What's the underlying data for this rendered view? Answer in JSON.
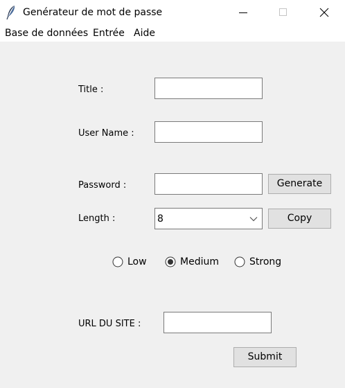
{
  "window": {
    "title": "Genérateur de mot de passe",
    "icon": "feather-icon",
    "controls": [
      "minimize-icon",
      "maximize-icon",
      "close-icon"
    ]
  },
  "menu": {
    "items": [
      "Base de données",
      "Entrée",
      "Aide"
    ]
  },
  "form": {
    "title_label": "Title :",
    "title_value": "",
    "username_label": "User Name :",
    "username_value": "",
    "password_label": "Password :",
    "password_value": "",
    "generate_label": "Generate",
    "length_label": "Length :",
    "length_value": "8",
    "copy_label": "Copy",
    "strength": {
      "options": [
        "Low",
        "Medium",
        "Strong"
      ],
      "selected": "Medium"
    },
    "url_label": "URL DU SITE :",
    "url_value": "",
    "submit_label": "Submit"
  }
}
